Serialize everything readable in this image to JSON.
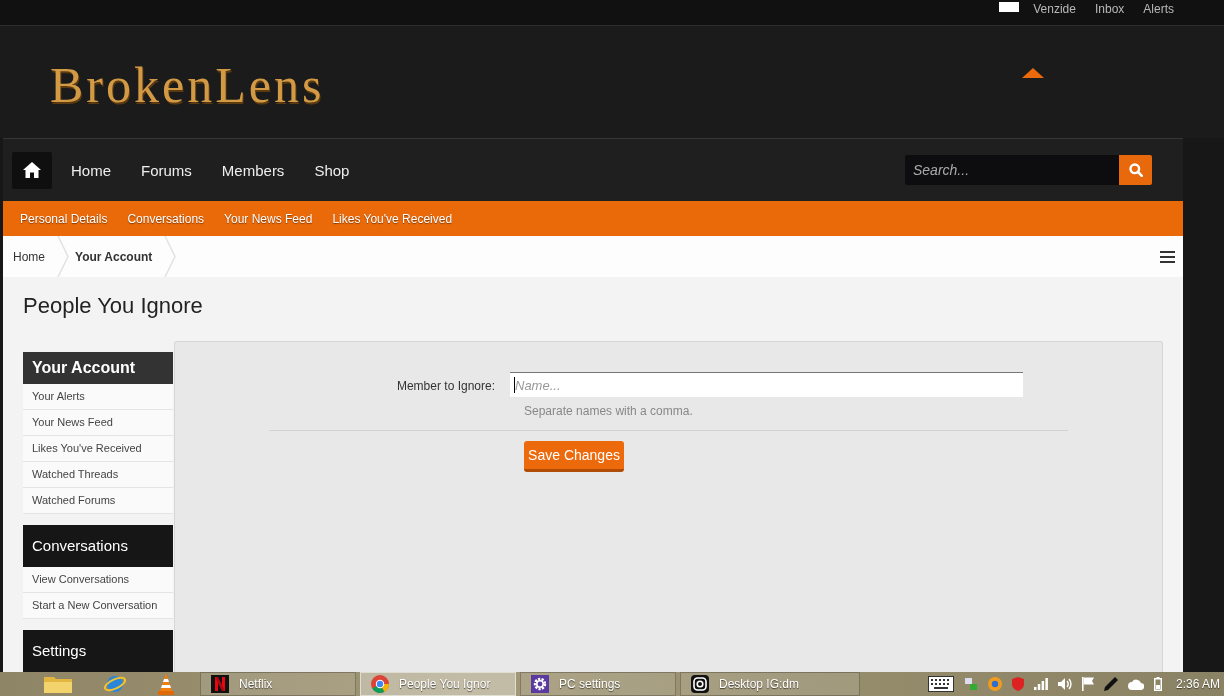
{
  "top_bar": {
    "links": [
      "Venzide",
      "Inbox",
      "Alerts"
    ]
  },
  "header": {
    "logo": "BrokenLens"
  },
  "nav": {
    "tabs": [
      "Home",
      "Forums",
      "Members",
      "Shop"
    ],
    "search": {
      "placeholder": "Search..."
    }
  },
  "sub_nav": [
    "Personal Details",
    "Conversations",
    "Your News Feed",
    "Likes You've Received"
  ],
  "breadcrumb": [
    {
      "label": "Home",
      "selected": false
    },
    {
      "label": "Your Account",
      "selected": true
    }
  ],
  "page_title": "People You Ignore",
  "sidebar": [
    {
      "title": "Your Account",
      "selected": true,
      "items": [
        "Your Alerts",
        "Your News Feed",
        "Likes You've Received",
        "Watched Threads",
        "Watched Forums"
      ]
    },
    {
      "title": "Conversations",
      "selected": false,
      "items": [
        "View Conversations",
        "Start a New Conversation"
      ]
    },
    {
      "title": "Settings",
      "selected": false
    }
  ],
  "form": {
    "label": "Member to Ignore:",
    "placeholder": "Name...",
    "focused": true,
    "hint": "Separate names with a comma.",
    "submit": "Save Changes"
  },
  "taskbar": {
    "windows": [
      {
        "label": "Netflix",
        "selected": false
      },
      {
        "label": "People You Ignor",
        "selected": true
      },
      {
        "label": "PC settings",
        "selected": false
      },
      {
        "label": "Desktop IG:dm",
        "selected": false
      }
    ],
    "clock": "2:36 AM"
  }
}
